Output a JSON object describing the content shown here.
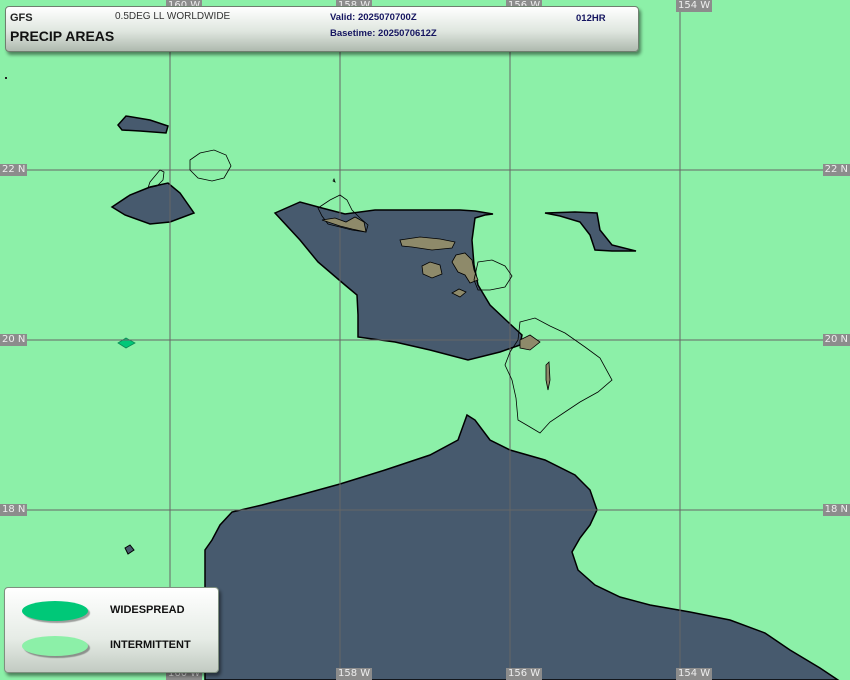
{
  "header": {
    "model": "GFS",
    "grid": "0.5DEG LL WORLDWIDE",
    "product": "PRECIP AREAS",
    "valid": "Valid: 2025070700Z",
    "basetime": "Basetime: 2025070612Z",
    "forecast_hour": "012HR"
  },
  "grid_labels": {
    "lon_top": {
      "lon160": "160 W",
      "lon158": "158 W",
      "lon156": "156 W",
      "lon154": "154 W"
    },
    "lon_bottom": {
      "lon160": "160 W",
      "lon158": "158 W",
      "lon156": "156 W",
      "lon154": "154 W"
    },
    "lat_left": {
      "lat22": "22 N",
      "lat20": "20 N",
      "lat18": "18 N"
    },
    "lat_right": {
      "lat22": "22 N",
      "lat20": "20 N",
      "lat18": "18 N"
    }
  },
  "legend": {
    "items": [
      {
        "label": "WIDESPREAD",
        "color": "#00c878"
      },
      {
        "label": "INTERMITTENT",
        "color": "#8cf0a8"
      }
    ]
  },
  "colors": {
    "background_intermittent": "#8cf0a8",
    "no_precip_ocean": "#475a6e",
    "land_no_precip": "#8e8a6a",
    "widespread": "#00c878"
  }
}
